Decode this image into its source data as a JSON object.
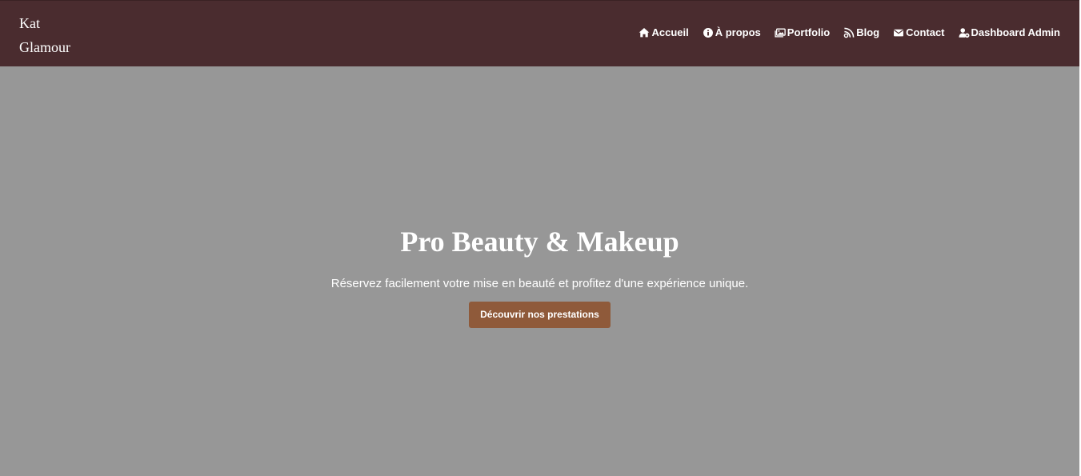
{
  "brand": {
    "line1": "Kat",
    "line2": "Glamour"
  },
  "nav": {
    "items": [
      {
        "label": "Accueil",
        "icon": "home-icon"
      },
      {
        "label": "À propos",
        "icon": "info-icon"
      },
      {
        "label": "Portfolio",
        "icon": "images-icon"
      },
      {
        "label": "Blog",
        "icon": "blog-icon"
      },
      {
        "label": "Contact",
        "icon": "envelope-icon"
      },
      {
        "label": "Dashboard Admin",
        "icon": "user-gear-icon"
      }
    ]
  },
  "hero": {
    "title": "Pro Beauty & Makeup",
    "subtitle": "Réservez facilement votre mise en beauté et profitez d'une expérience unique.",
    "cta_label": "Découvrir nos prestations"
  },
  "colors": {
    "navbar": "#4a2c2f",
    "hero_background": "#979797",
    "cta": "#8f5a3a",
    "text": "#ffffff"
  }
}
